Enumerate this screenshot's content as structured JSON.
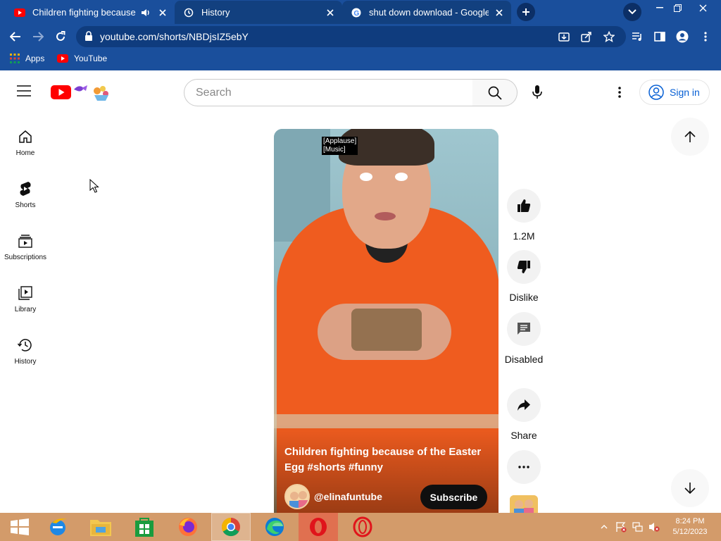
{
  "browser": {
    "tabs": [
      {
        "title": "Children fighting because of",
        "state": "active",
        "icon": "youtube-favicon-icon",
        "audio": true
      },
      {
        "title": "History",
        "state": "inactive",
        "icon": "history-favicon-icon",
        "audio": false
      },
      {
        "title": "shut down download - Google Se",
        "state": "inactive",
        "icon": "google-favicon-icon",
        "audio": false
      }
    ],
    "url": "youtube.com/shorts/NBDjsIZ5ebY",
    "bookmarks": [
      {
        "label": "Apps",
        "icon": "apps-grid-icon"
      },
      {
        "label": "YouTube",
        "icon": "youtube-favicon-icon"
      }
    ],
    "colors": {
      "chrome": "#1a4f9c",
      "omnibox": "#0f3c7e"
    }
  },
  "header": {
    "search_placeholder": "Search",
    "signin_label": "Sign in"
  },
  "sidebar": {
    "items": [
      {
        "label": "Home",
        "icon": "home-icon"
      },
      {
        "label": "Shorts",
        "icon": "shorts-icon"
      },
      {
        "label": "Subscriptions",
        "icon": "subscriptions-icon"
      },
      {
        "label": "Library",
        "icon": "library-icon"
      },
      {
        "label": "History",
        "icon": "history-icon"
      }
    ]
  },
  "short": {
    "caption_lines": [
      "[Applause]",
      "[Music]"
    ],
    "title": "Children fighting because of the Easter Egg #shorts #funny",
    "channel": "@elinafuntube",
    "subscribe_label": "Subscribe"
  },
  "actions": {
    "like_count": "1.2M",
    "dislike_label": "Dislike",
    "comments_label": "Disabled",
    "share_label": "Share"
  },
  "taskbar": {
    "apps": [
      "start",
      "internet-explorer",
      "file-explorer",
      "store",
      "firefox",
      "chrome",
      "edge",
      "opera",
      "opera-gx"
    ],
    "active_app": "chrome",
    "time": "8:24 PM",
    "date": "5/12/2023",
    "color": "#d39b6a"
  }
}
